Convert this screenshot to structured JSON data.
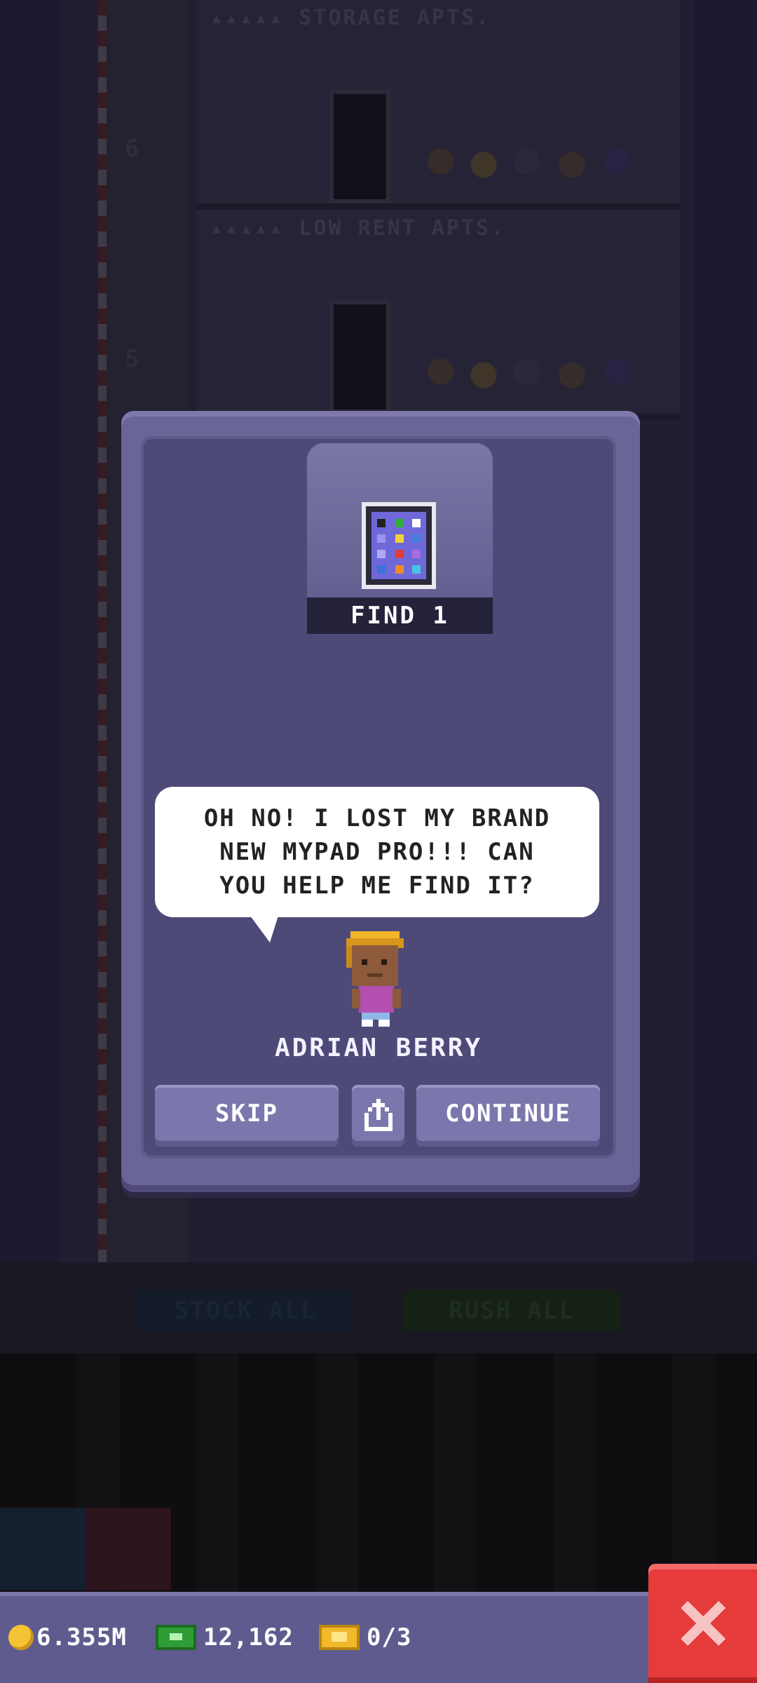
{
  "background": {
    "floors": [
      {
        "label": "▴▴▴▴▴ STORAGE APTS.",
        "number": "6"
      },
      {
        "label": "▴▴▴▴▴ LOW RENT APTS.",
        "number": "5"
      }
    ],
    "actions": {
      "stock_all": "STOCK ALL",
      "rush_all": "RUSH ALL"
    }
  },
  "dialog": {
    "find_label": "FIND 1",
    "item_icon": "tablet-icon",
    "speech_lines": [
      "OH NO! I LOST MY BRAND",
      "NEW MYPAD PRO!!! CAN",
      "YOU HELP ME FIND IT?"
    ],
    "character_name": "ADRIAN BERRY",
    "buttons": {
      "skip": "SKIP",
      "share_icon": "share-icon",
      "continue": "CONTINUE"
    }
  },
  "hud": {
    "coins": "6.355M",
    "bux": "12,162",
    "tickets": "0/3",
    "close_icon": "close-icon"
  },
  "colors": {
    "dialog_outer": "#6a6597",
    "dialog_inner": "#4e4a78",
    "button": "#7b77ad",
    "close_button": "#e53b3b",
    "hud_bar": "#5f5b8e"
  }
}
